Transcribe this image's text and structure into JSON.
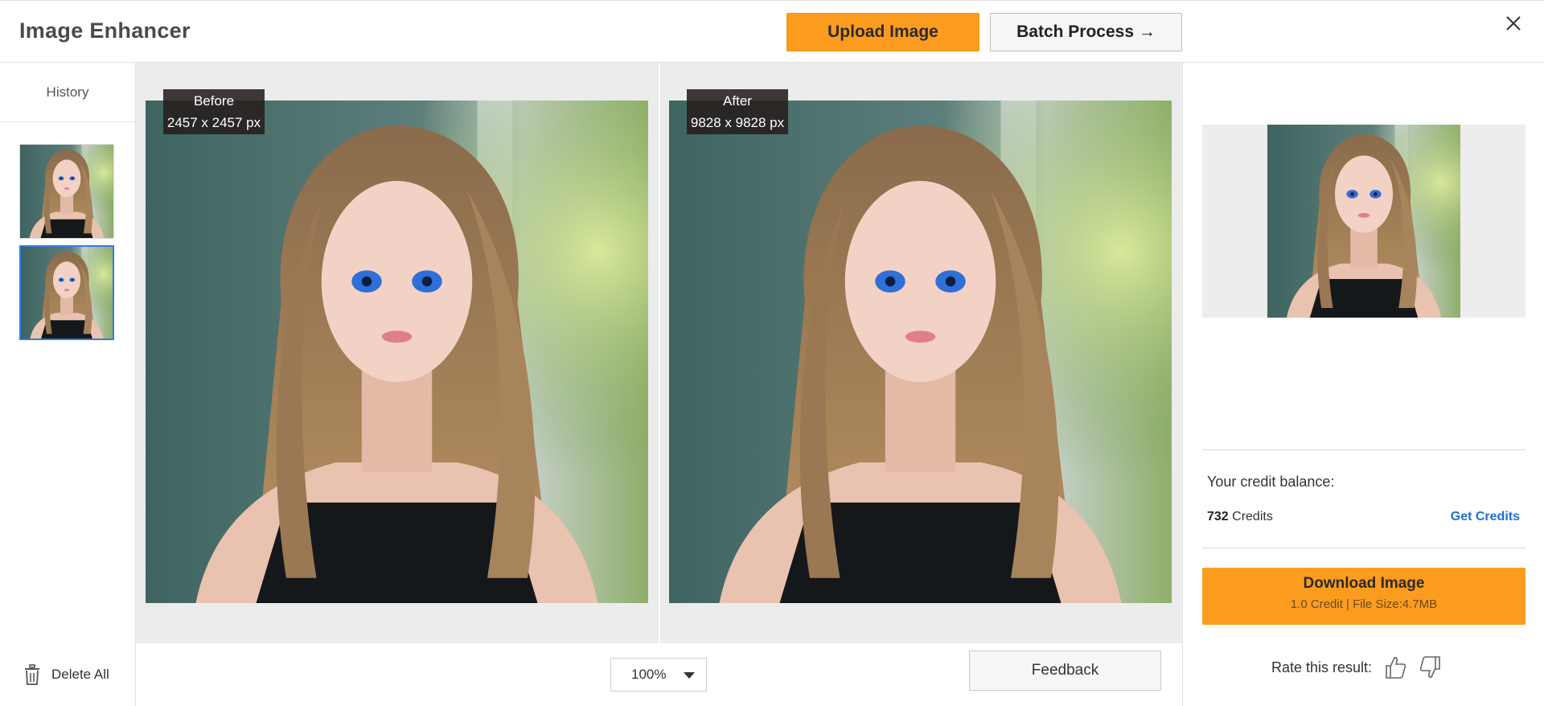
{
  "header": {
    "title": "Image Enhancer",
    "upload_label": "Upload Image",
    "batch_label": "Batch Process →"
  },
  "sidebar": {
    "history_label": "History",
    "delete_all_label": "Delete All"
  },
  "compare": {
    "before": {
      "label": "Before",
      "size": "2457 x 2457 px"
    },
    "after": {
      "label": "After",
      "size": "9828 x 9828 px"
    }
  },
  "toolbar": {
    "zoom_value": "100%",
    "feedback_label": "Feedback"
  },
  "credits": {
    "title": "Your credit balance:",
    "balance": "732",
    "unit": " Credits",
    "get_credits_label": "Get Credits"
  },
  "download": {
    "label": "Download Image",
    "detail": "1.0 Credit | File Size:4.7MB"
  },
  "rating": {
    "label": "Rate this result:"
  },
  "colors": {
    "accent": "#fc9c1e",
    "link": "#1e6fd6",
    "selected_border": "#2f7de1"
  },
  "icons": {
    "close": "close-icon",
    "trash": "trash-icon",
    "thumbs_up": "thumbs-up-icon",
    "thumbs_down": "thumbs-down-icon",
    "zoom_caret": "chevron-down-icon"
  }
}
